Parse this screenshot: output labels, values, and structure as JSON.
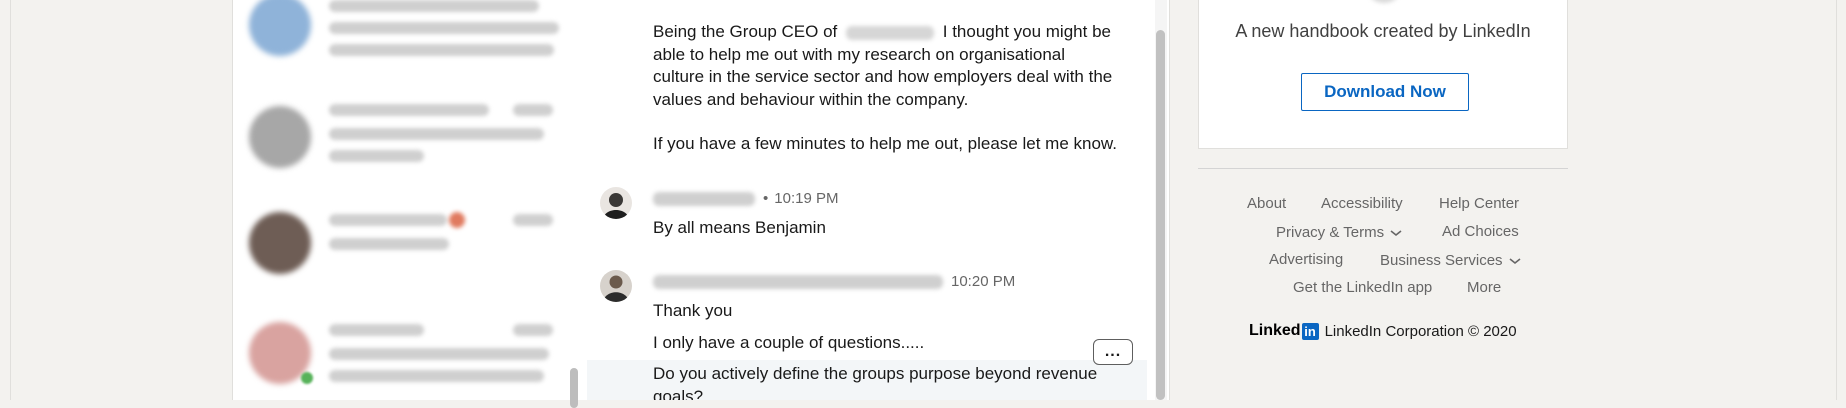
{
  "conversations": [
    {
      "avatar_color": "#8fb3d9"
    },
    {
      "avatar_color": "#a7a7a7"
    },
    {
      "avatar_color": "#6e5d55"
    },
    {
      "avatar_color": "#d9a3a0"
    }
  ],
  "thread": {
    "intro_before": "Being the Group CEO of",
    "intro_after": "I thought you might be",
    "intro_lines": [
      "able to help me out with my research on organisational",
      "culture in the service sector and how employers deal with the",
      "values and behaviour within the company."
    ],
    "follow_up": "If you have a few minutes to help me out, please let me know.",
    "reply_time": "10:19 PM",
    "reply_text": "By all means Benjamin",
    "second_time": "10:20 PM",
    "msg_thank": "Thank you",
    "msg_questions": "I only have a couple of questions.....",
    "msg_purpose_line1": "Do you actively define the groups purpose beyond revenue",
    "msg_purpose_line2": "goals?",
    "more_label": "..."
  },
  "ad": {
    "text": "A new handbook created by LinkedIn",
    "button": "Download Now"
  },
  "footer": {
    "links": {
      "about": "About",
      "accessibility": "Accessibility",
      "help_center": "Help Center",
      "privacy_terms": "Privacy & Terms",
      "ad_choices": "Ad Choices",
      "advertising": "Advertising",
      "business_services": "Business Services",
      "get_app": "Get the LinkedIn app",
      "more": "More"
    },
    "brand_word": "Linked",
    "brand_box": "in",
    "copyright": "LinkedIn Corporation © 2020"
  },
  "colors": {
    "brand_blue": "#0a66c2",
    "background": "#f3f2ef",
    "muted_text": "#666666"
  }
}
